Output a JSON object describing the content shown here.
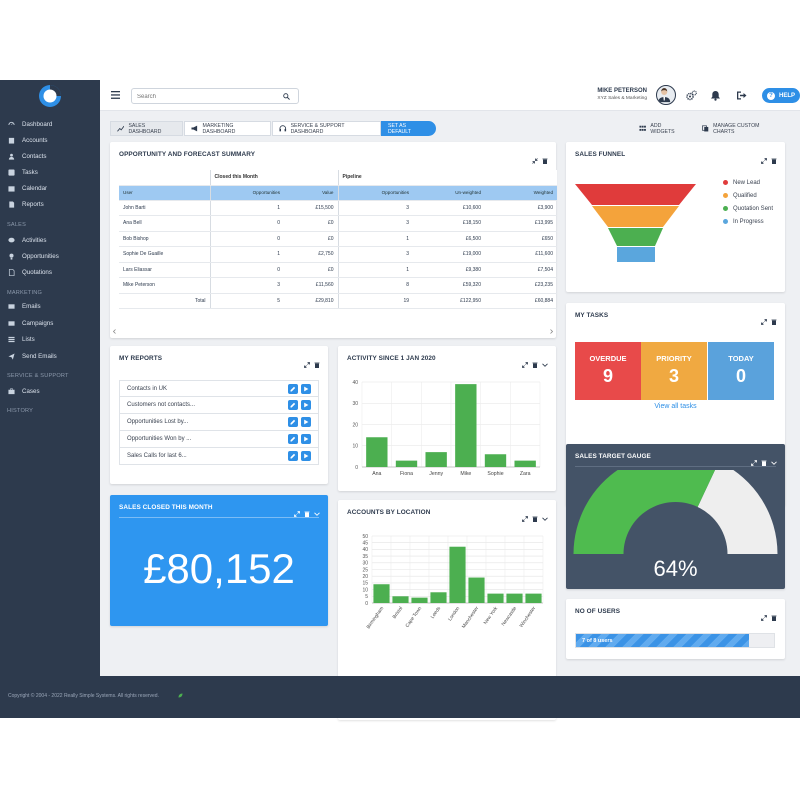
{
  "sidebar": {
    "items": [
      {
        "label": "Dashboard",
        "icon": "dashboard-icon"
      },
      {
        "label": "Accounts",
        "icon": "building-icon"
      },
      {
        "label": "Contacts",
        "icon": "contacts-icon"
      },
      {
        "label": "Tasks",
        "icon": "check-icon"
      },
      {
        "label": "Calendar",
        "icon": "calendar-icon"
      },
      {
        "label": "Reports",
        "icon": "reports-icon"
      },
      {
        "label": "Activities",
        "icon": "chat-icon"
      },
      {
        "label": "Opportunities",
        "icon": "bulb-icon"
      },
      {
        "label": "Quotations",
        "icon": "document-icon"
      },
      {
        "label": "Emails",
        "icon": "mail-icon"
      },
      {
        "label": "Campaigns",
        "icon": "mail-icon"
      },
      {
        "label": "Lists",
        "icon": "list-icon"
      },
      {
        "label": "Send Emails",
        "icon": "send-icon"
      },
      {
        "label": "Cases",
        "icon": "case-icon"
      }
    ],
    "sections": [
      "SALES",
      "MARKETING",
      "SERVICE & SUPPORT",
      "HISTORY"
    ]
  },
  "topbar": {
    "search_placeholder": "Search",
    "user_name": "MIKE PETERSON",
    "user_role": "XYZ Sales & Marketing",
    "help_label": "HELP",
    "help_glyph": "?"
  },
  "tabs": {
    "sales": "SALES DASHBOARD",
    "marketing": "MARKETING DASHBOARD",
    "service": "SERVICE & SUPPORT DASHBOARD",
    "default": "SET AS DEFAULT",
    "add_widgets": "ADD WIDGETS",
    "manage_charts": "MANAGE CUSTOM CHARTS"
  },
  "forecast": {
    "title": "OPPORTUNITY AND FORECAST SUMMARY",
    "group_headers": [
      "Closed this Month",
      "Pipeline"
    ],
    "columns": [
      "User",
      "Opportunities",
      "Value",
      "Opportunities",
      "Un-weighted",
      "Weighted"
    ],
    "rows": [
      [
        "John Barti",
        "1",
        "£15,500",
        "3",
        "£10,600",
        "£3,900"
      ],
      [
        "Ana Bell",
        "0",
        "£0",
        "3",
        "£18,150",
        "£13,995"
      ],
      [
        "Bob Bishop",
        "0",
        "£0",
        "1",
        "£6,500",
        "£650"
      ],
      [
        "Sophie De Guaille",
        "1",
        "£2,750",
        "3",
        "£19,000",
        "£11,600"
      ],
      [
        "Lars Eliassar",
        "0",
        "£0",
        "1",
        "£9,380",
        "£7,504"
      ],
      [
        "Mike Peterson",
        "3",
        "£11,560",
        "8",
        "£59,320",
        "£23,235"
      ]
    ],
    "total": [
      "Total",
      "5",
      "£29,810",
      "19",
      "£122,950",
      "£60,884"
    ]
  },
  "funnel": {
    "title": "SALES FUNNEL",
    "legend": [
      {
        "label": "New Lead",
        "color": "#e03b3b"
      },
      {
        "label": "Qualified",
        "color": "#f4a33b"
      },
      {
        "label": "Quotation Sent",
        "color": "#4caf50"
      },
      {
        "label": "In Progress",
        "color": "#5aa6dd"
      }
    ]
  },
  "reports": {
    "title": "MY REPORTS",
    "items": [
      "Contacts in UK",
      "Customers not contacts...",
      "Opportunities Lost by...",
      "Opportunities Won by ...",
      "Sales Calls for last 6..."
    ]
  },
  "activity": {
    "title": "ACTIVITY SINCE 1 JAN 2020"
  },
  "tasks": {
    "title": "MY TASKS",
    "boxes": [
      {
        "label": "OVERDUE",
        "count": "9",
        "color": "#e84a4a"
      },
      {
        "label": "PRIORITY",
        "count": "3",
        "color": "#f0a941"
      },
      {
        "label": "TODAY",
        "count": "0",
        "color": "#5aa2dc"
      }
    ],
    "view_all": "View all tasks"
  },
  "sales_closed": {
    "title": "SALES CLOSED THIS MONTH",
    "value": "£80,152"
  },
  "locations": {
    "title": "ACCOUNTS BY LOCATION"
  },
  "gauge": {
    "title": "SALES TARGET GAUGE",
    "percent": 64,
    "label": "64%"
  },
  "users": {
    "title": "NO OF USERS",
    "label": "7 of 8 users",
    "fraction": 0.875
  },
  "footer": {
    "text": "Copyright © 2004 - 2022 Really Simple Systems. All rights reserved."
  },
  "chart_data": [
    {
      "type": "bar",
      "title": "ACTIVITY SINCE 1 JAN 2020",
      "categories": [
        "Ana",
        "Fiona",
        "Jenny",
        "Mike",
        "Sophie",
        "Zara"
      ],
      "values": [
        14,
        3,
        7,
        39,
        6,
        3
      ],
      "ylim": [
        0,
        40
      ],
      "yticks": [
        "0",
        "10",
        "20",
        "30",
        "40"
      ],
      "grid": true,
      "color": "#4caf50"
    },
    {
      "type": "bar",
      "title": "ACCOUNTS BY LOCATION",
      "categories": [
        "Birmingham",
        "Bristol",
        "Cape Town",
        "Leeds",
        "London",
        "Manchester",
        "New York",
        "Newcastle",
        "Winchester"
      ],
      "values": [
        14,
        5,
        4,
        8,
        42,
        19,
        7,
        7,
        7
      ],
      "ylim": [
        0,
        50
      ],
      "yticks": [
        "0",
        "5",
        "10",
        "15",
        "20",
        "25",
        "30",
        "35",
        "40",
        "45",
        "50"
      ],
      "grid": true,
      "color": "#4caf50"
    }
  ]
}
